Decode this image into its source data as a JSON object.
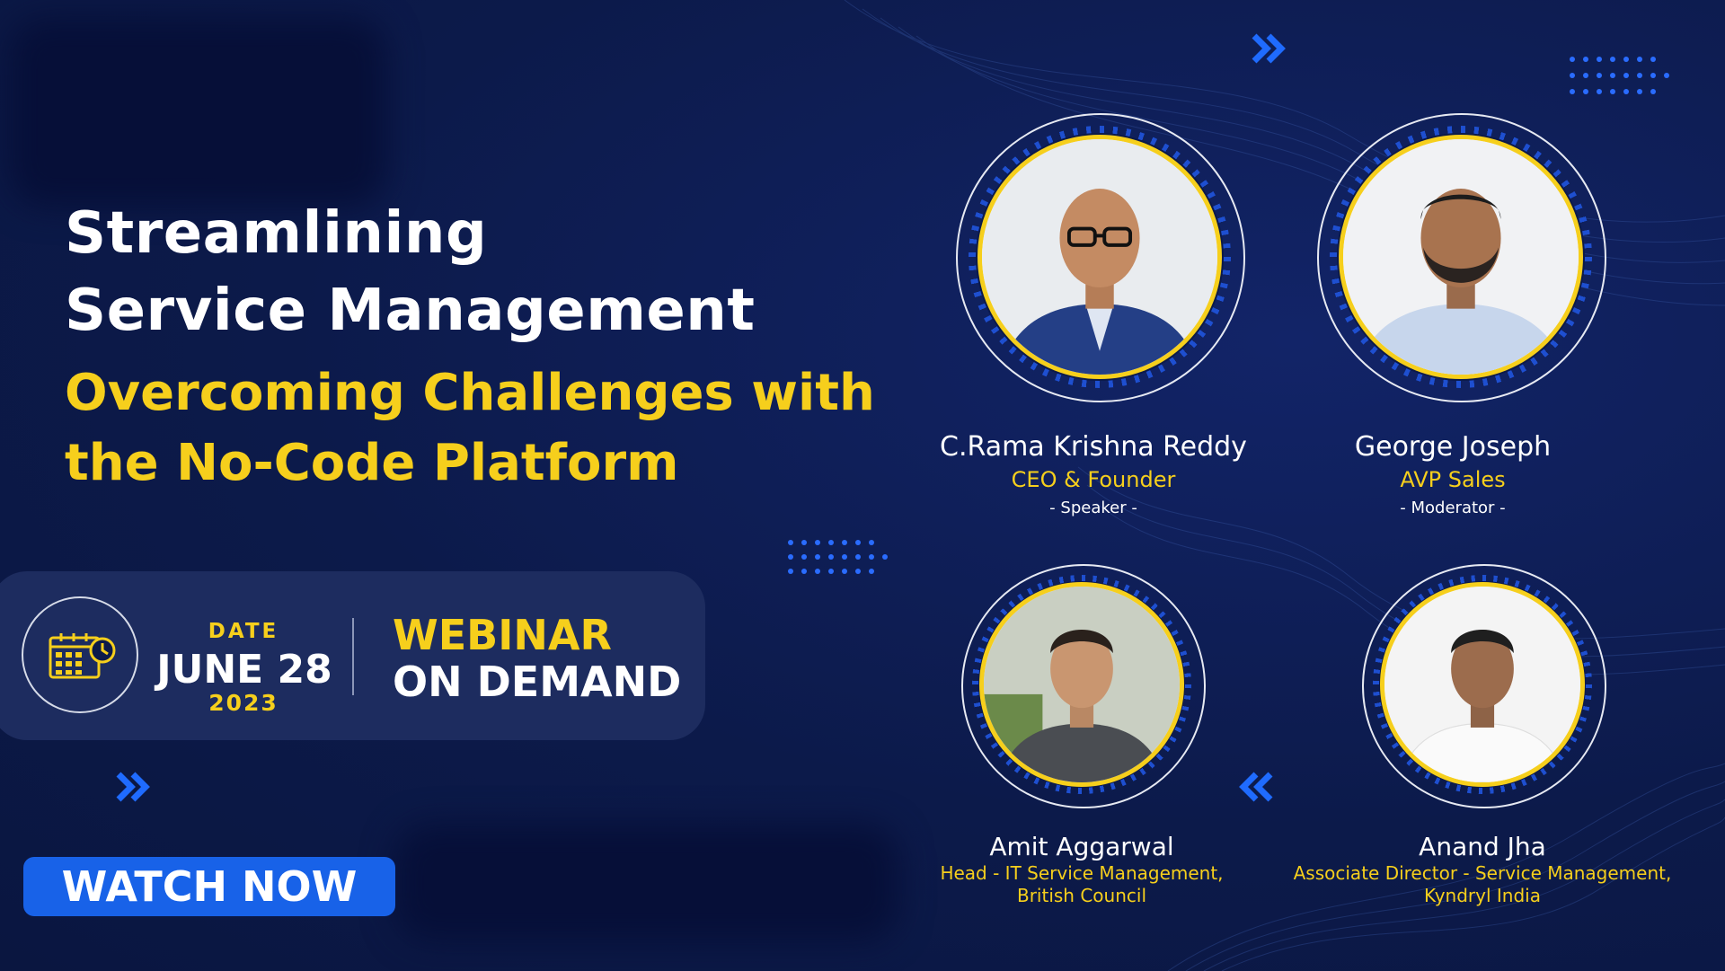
{
  "title": {
    "line1": "Streamlining",
    "line2": "Service Management",
    "subtitle_line1": "Overcoming Challenges with",
    "subtitle_line2": "the No-Code Platform"
  },
  "event": {
    "date_label": "DATE",
    "date": "JUNE 28",
    "year": "2023",
    "type_line1": "WEBINAR",
    "type_line2": "ON DEMAND"
  },
  "cta": {
    "label": "WATCH NOW"
  },
  "speakers": [
    {
      "name": "C.Rama Krishna Reddy",
      "role": "CEO & Founder",
      "tag": "- Speaker -"
    },
    {
      "name": "George Joseph",
      "role": "AVP Sales",
      "tag": "- Moderator -"
    },
    {
      "name": "Amit Aggarwal",
      "role_line1": "Head - IT Service Management,",
      "role_line2": "British Council"
    },
    {
      "name": "Anand Jha",
      "role_line1": "Associate Director - Service Management,",
      "role_line2": "Kyndryl India"
    }
  ],
  "colors": {
    "background": "#0c1a4a",
    "accent_yellow": "#f6cf1c",
    "accent_blue": "#1862e8",
    "panel": "#1d2c5f"
  },
  "icons": [
    "calendar-clock-icon",
    "double-chevron-right-icon",
    "double-chevron-left-icon",
    "dot-grid-decoration"
  ]
}
